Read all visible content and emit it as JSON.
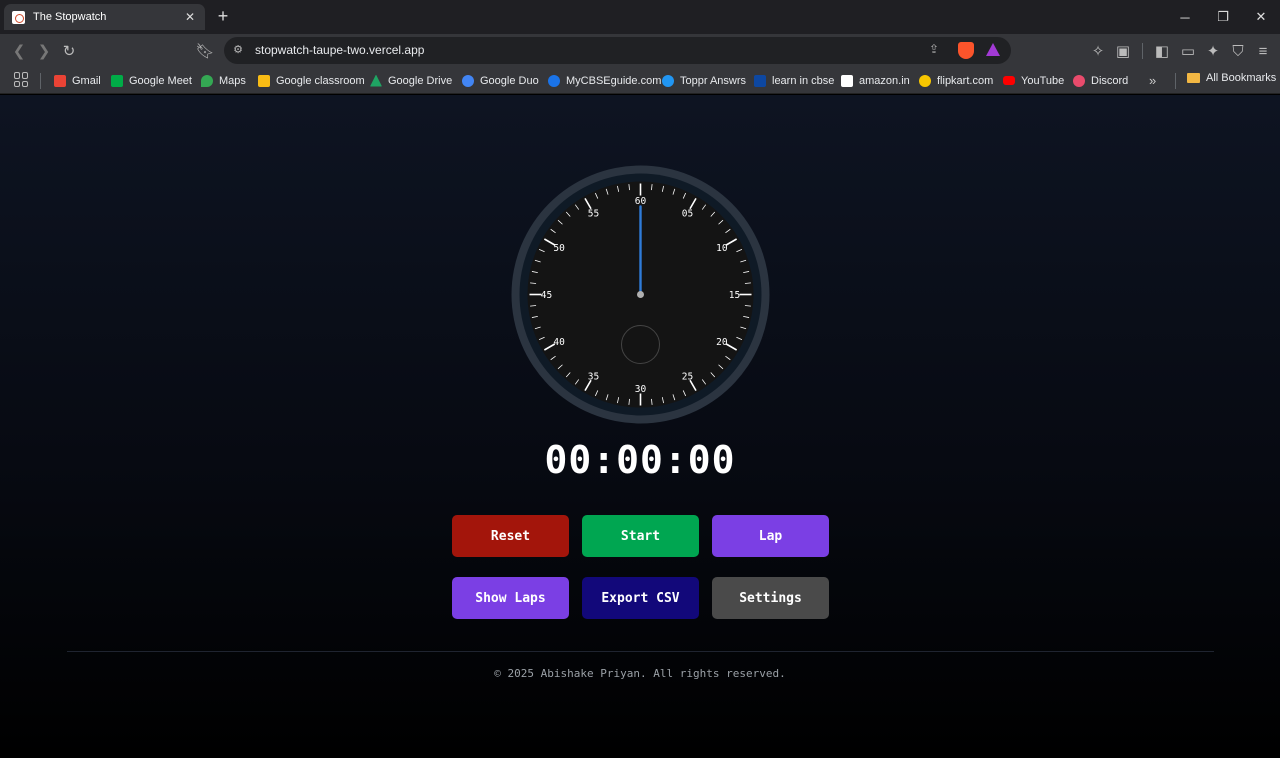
{
  "browser": {
    "tab": {
      "title": "The Stopwatch",
      "favicon": "stopwatch-favicon"
    },
    "url": "stopwatch-taupe-two.vercel.app",
    "bookmarks": [
      {
        "label": "Gmail",
        "icon": "gmail-icon",
        "color": "#ea4335"
      },
      {
        "label": "Google Meet",
        "icon": "google-meet-icon",
        "color": "#00ac47"
      },
      {
        "label": "Maps",
        "icon": "maps-icon",
        "color": "#34a853"
      },
      {
        "label": "Google classroom",
        "icon": "classroom-icon",
        "color": "#f9bc15"
      },
      {
        "label": "Google Drive",
        "icon": "drive-icon",
        "color": "#1fa463"
      },
      {
        "label": "Google Duo",
        "icon": "duo-icon",
        "color": "#4285f4"
      },
      {
        "label": "MyCBSEguide.com",
        "icon": "mycbseguide-icon",
        "color": "#1a73e8"
      },
      {
        "label": "Toppr Answrs",
        "icon": "toppr-icon",
        "color": "#2196f3"
      },
      {
        "label": "learn in cbse",
        "icon": "learncbse-icon",
        "color": "#0d47a1"
      },
      {
        "label": "amazon.in",
        "icon": "amazon-icon",
        "color": "#ffffff"
      },
      {
        "label": "flipkart.com",
        "icon": "flipkart-icon",
        "color": "#f7c600"
      },
      {
        "label": "YouTube",
        "icon": "youtube-icon",
        "color": "#ff0000"
      },
      {
        "label": "Discord",
        "icon": "discord-icon",
        "color": "#e94b6c"
      }
    ],
    "more_bookmarks": "»",
    "all_bookmarks": "All Bookmarks"
  },
  "stopwatch": {
    "dial_labels": [
      "60",
      "05",
      "10",
      "15",
      "20",
      "25",
      "30",
      "35",
      "40",
      "45",
      "50",
      "55"
    ],
    "hand_seconds": 0,
    "time": "00:00:00",
    "colors": {
      "hand": "#2f7bd8",
      "bezel": "#2b3440",
      "face": "#141414"
    }
  },
  "buttons": {
    "reset": {
      "label": "Reset",
      "color": "#a3150b"
    },
    "start": {
      "label": "Start",
      "color": "#00a651"
    },
    "lap": {
      "label": "Lap",
      "color": "#7b3fe4"
    },
    "show_laps": {
      "label": "Show Laps",
      "color": "#7b3fe4"
    },
    "export_csv": {
      "label": "Export CSV",
      "color": "#12087a"
    },
    "settings": {
      "label": "Settings",
      "color": "#4a4a4a"
    }
  },
  "footer": {
    "text": "© 2025 Abishake Priyan. All rights reserved."
  }
}
